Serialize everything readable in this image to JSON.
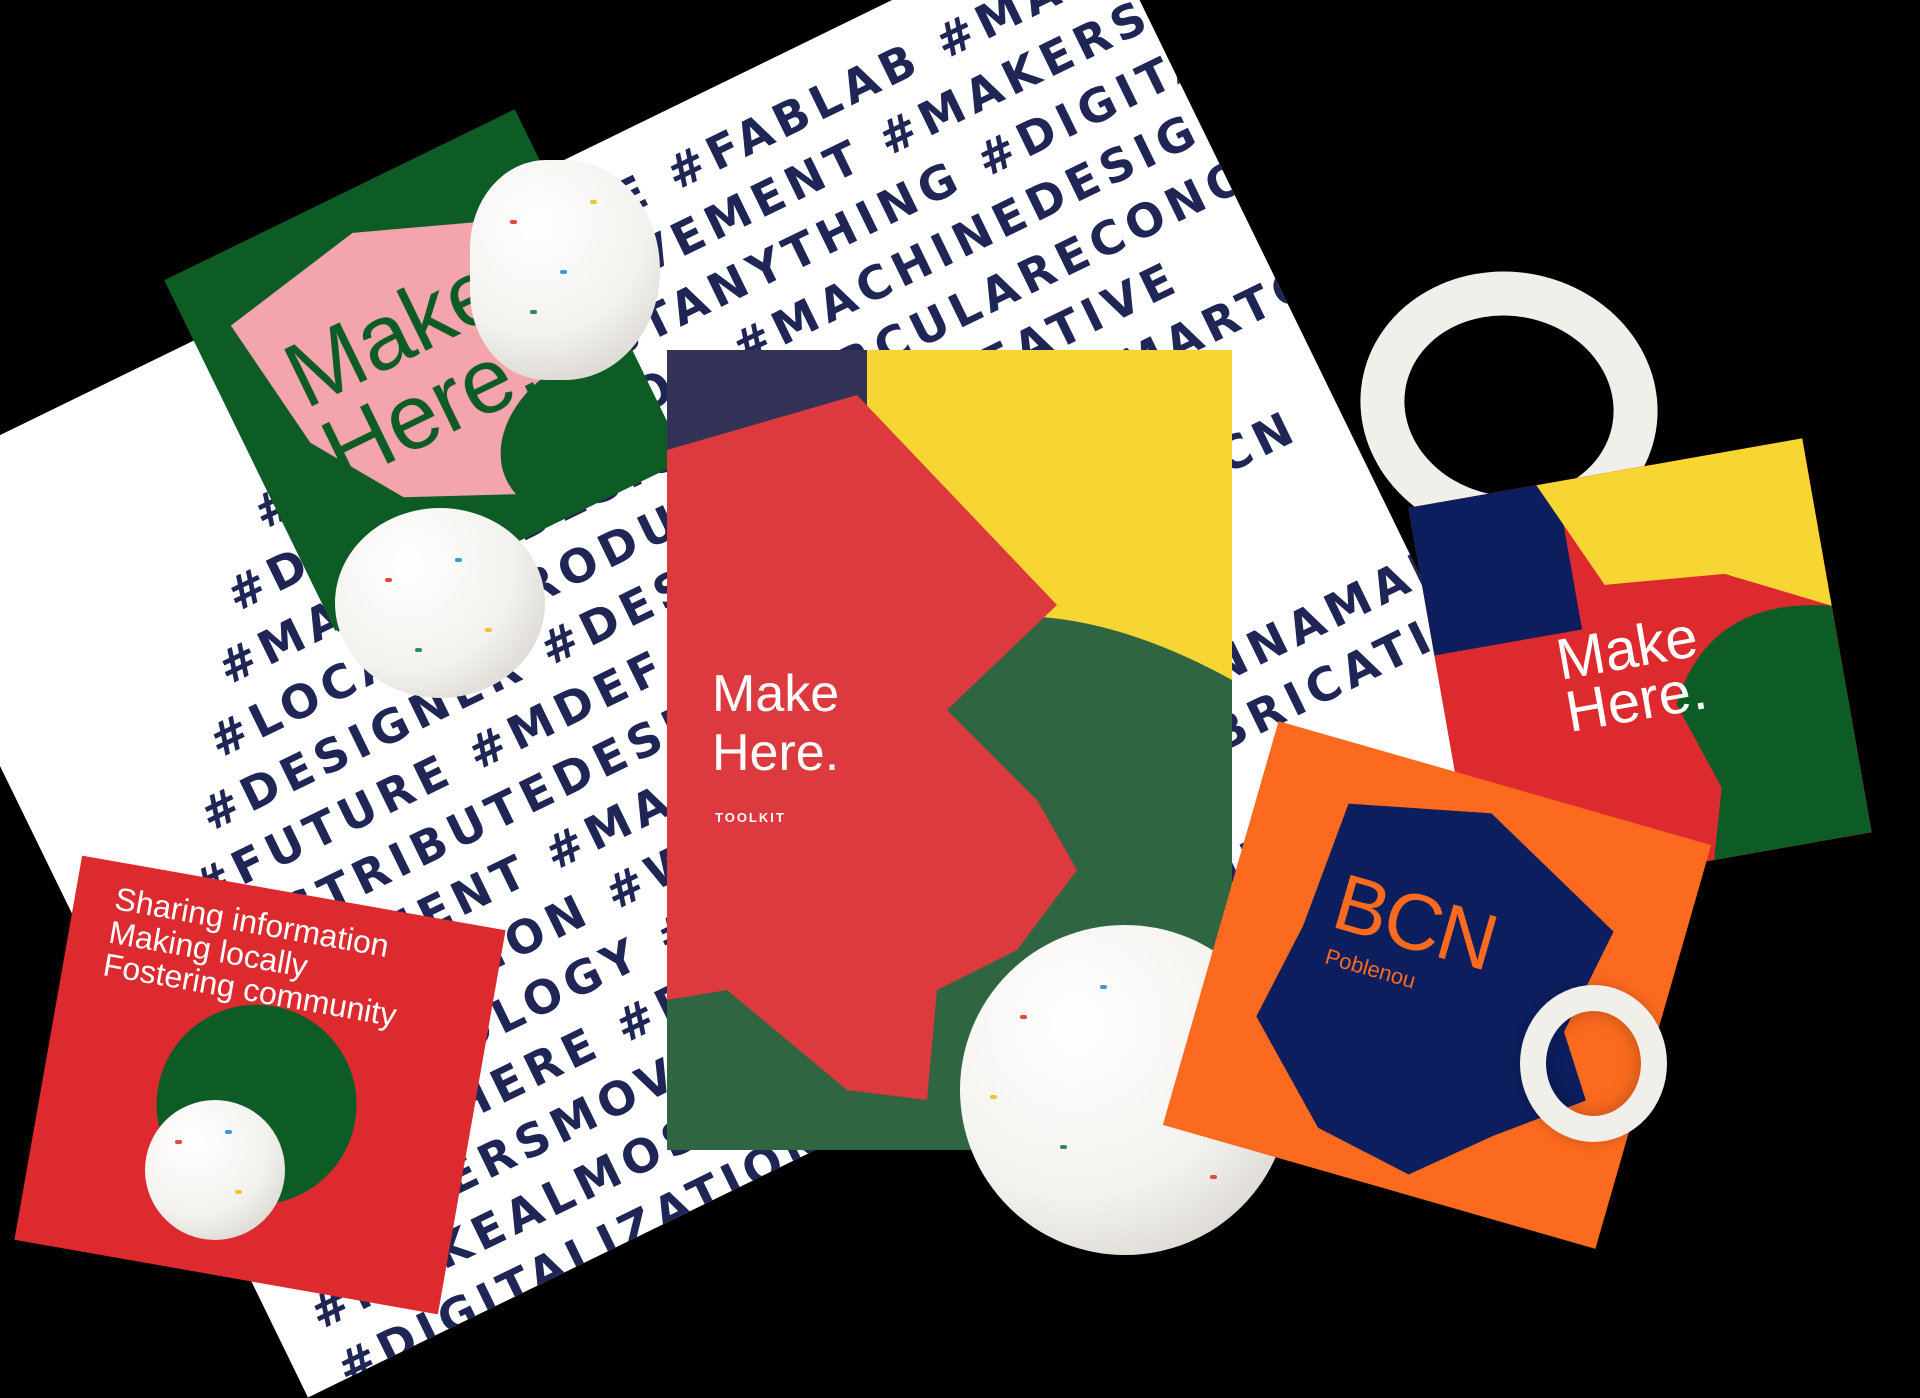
{
  "poster": {
    "lines": [
      "#MAKEHERE #FABLAB #MAKER",
      "#MAKERSMOVEMENT #MAKERSGONNAMAKE",
      "#MAKEALMOSTANYTHING #DIGITALFABRICATION",
      "#DIGITALIZATION #MACHINEDESIGN #MACHINE",
      "#MACHINEDESIGN #CIRCULARECONOMY",
      "#LOCAL #PRODUCTION #CREATIVE",
      "#DESIGNER #DESIGN #VALUE #SMARTCITY",
      "#FUTURE #MDEF #INNOVATION",
      "#DISTRIBUTEDESIGN #POBLENOU #BCN",
      "#MOVEMENT #MAKERS #DIGITALART",
      "#INNOVATION #WORKSHOP #MAKER",
      "#TECHNOLOGY #OPENSOURCE #GONNAMAKE",
      "#MAKEHERE #FABLAB #DIGITALFABRICATION",
      "#MAKERSMOVEMENT #MACHINE",
      "#MAKEALMOSTANYTHING #3DPRINTING",
      "#DIGITALIZATION #3DPRINTING",
      "#MACHINEDESIGN #PRODUCTION"
    ]
  },
  "card_pink": {
    "line1": "Make",
    "line2": "Here."
  },
  "card_main": {
    "line1": "Make",
    "line2": "Here.",
    "sub": "TOOLKIT"
  },
  "card_right": {
    "line1": "Make",
    "line2": "Here."
  },
  "card_bcn": {
    "title": "BCN",
    "sub": "Poblenou"
  },
  "card_red": {
    "lines": [
      "Sharing information",
      "Making locally",
      "Fostering community"
    ]
  },
  "colors": {
    "background": "#000000",
    "navy": "#1f2555",
    "red": "#dc3a3f",
    "green": "#2f6540",
    "dark_green": "#0e5c25",
    "yellow": "#f7d532",
    "pink": "#f3a4ad",
    "orange": "#fb6a1f",
    "blue": "#0c1e5e"
  }
}
